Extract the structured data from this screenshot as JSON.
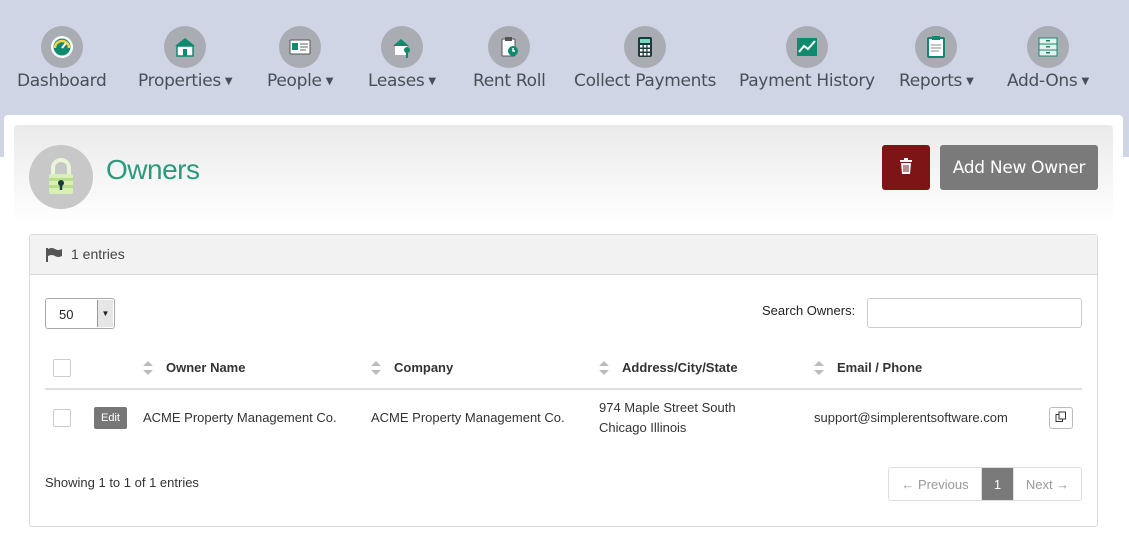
{
  "nav": {
    "items": [
      {
        "label": "Dashboard",
        "icon": "dashboard-gauge-icon",
        "dropdown": false
      },
      {
        "label": "Properties",
        "icon": "house-icon",
        "dropdown": true
      },
      {
        "label": "People",
        "icon": "id-card-icon",
        "dropdown": true
      },
      {
        "label": "Leases",
        "icon": "house-key-icon",
        "dropdown": true
      },
      {
        "label": "Rent Roll",
        "icon": "clipboard-clock-icon",
        "dropdown": false
      },
      {
        "label": "Collect Payments",
        "icon": "calculator-icon",
        "dropdown": false
      },
      {
        "label": "Payment History",
        "icon": "line-chart-icon",
        "dropdown": false
      },
      {
        "label": "Reports",
        "icon": "clipboard-icon",
        "dropdown": true
      },
      {
        "label": "Add-Ons",
        "icon": "cabinet-icon",
        "dropdown": true
      }
    ]
  },
  "page": {
    "title": "Owners",
    "icon": "padlock-icon",
    "add_button": "Add New Owner",
    "delete_icon": "trash-icon"
  },
  "panel": {
    "entries_label": "1 entries",
    "page_length": "50",
    "search_label": "Search Owners:",
    "search_value": ""
  },
  "table": {
    "columns": [
      "Owner Name",
      "Company",
      "Address/City/State",
      "Email / Phone"
    ],
    "rows": [
      {
        "edit_label": "Edit",
        "owner_name": "ACME Property Management Co.",
        "company": "ACME Property Management Co.",
        "address_line1": "974 Maple Street South",
        "address_line2": "Chicago Illinois",
        "email": "support@simplerentsoftware.com"
      }
    ]
  },
  "footer": {
    "showing": "Showing 1 to 1 of 1 entries",
    "prev": "← Previous",
    "current_page": "1",
    "next": "Next →"
  },
  "colors": {
    "nav_bg": "#cfd5e5",
    "title": "#2a9a7d",
    "delete_btn": "#7d1416",
    "add_btn": "#7a7a7a",
    "icon_accent": "#0e8a6e"
  }
}
